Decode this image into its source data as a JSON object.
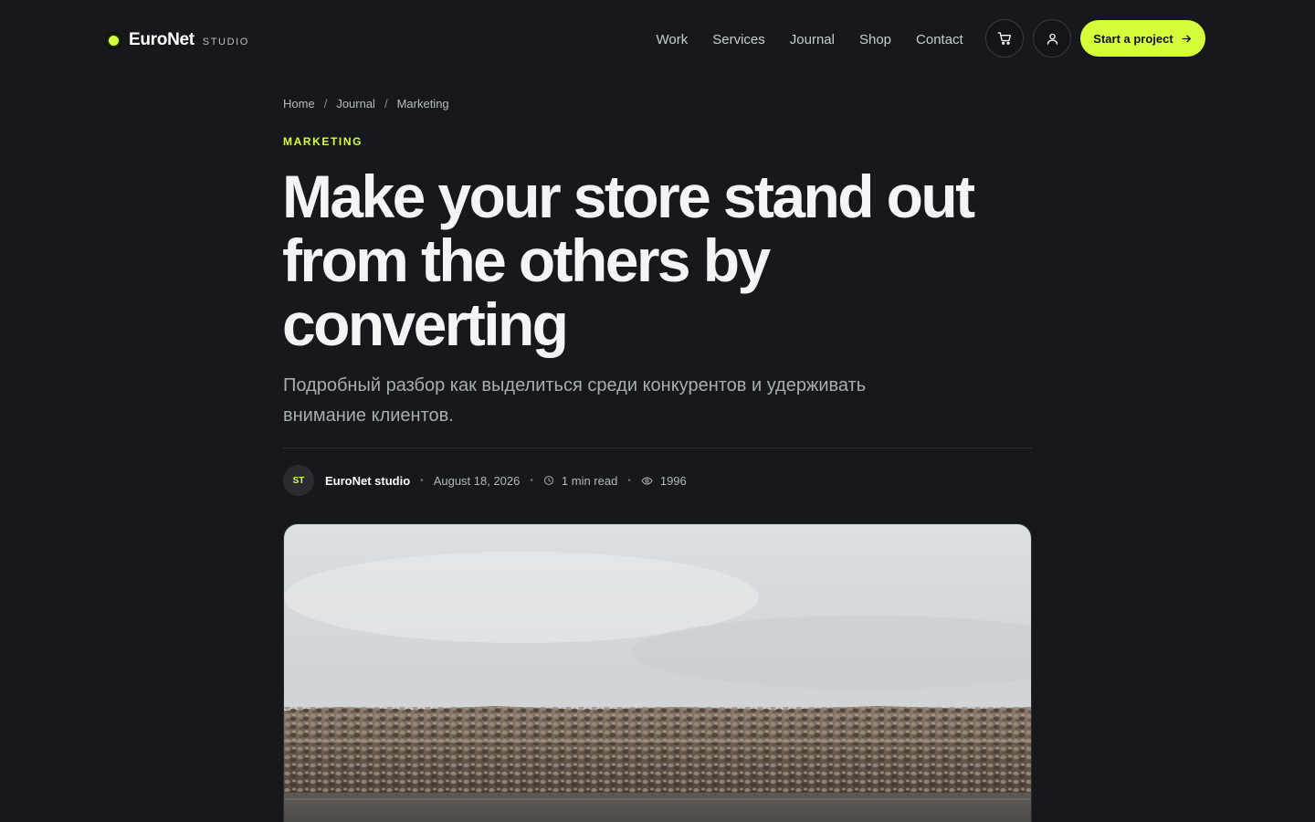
{
  "header": {
    "logo_name": "EuroNet",
    "logo_sub": "STUDIO",
    "nav": [
      "Work",
      "Services",
      "Journal",
      "Shop",
      "Contact"
    ],
    "cart_icon": "cart-icon",
    "user_icon": "user-icon",
    "cta_label": "Start a project",
    "cta_icon": "arrow-right-icon"
  },
  "breadcrumb": [
    "Home",
    "Journal",
    "Marketing"
  ],
  "article": {
    "category": "MARKETING",
    "title": "Make your store stand out from the others by converting",
    "subtitle": "Подробный разбор как выделиться среди конкурентов и удерживать внимание клиентов.",
    "author_initials": "ST",
    "author": "EuroNet studio",
    "date": "August 18, 2026",
    "read_time": "1 min read",
    "views": "1996"
  },
  "colors": {
    "background": "#17181c",
    "accent": "#d4ff3a"
  }
}
